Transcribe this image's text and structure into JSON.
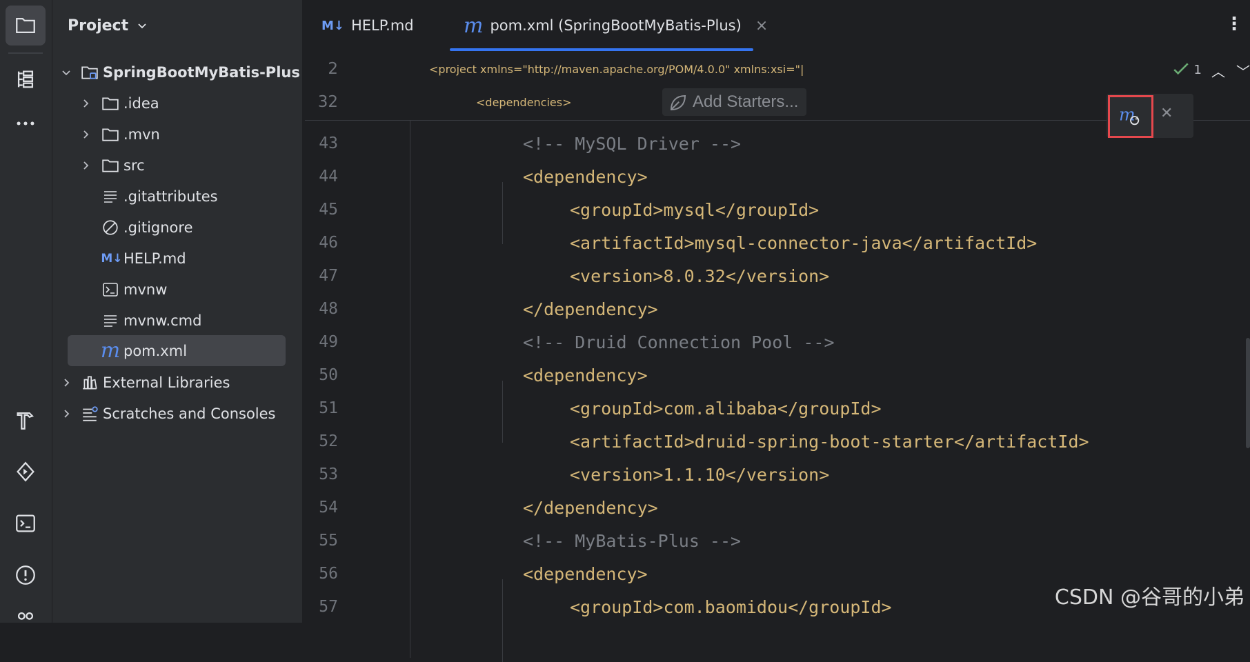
{
  "project_panel": {
    "title": "Project",
    "tree": [
      {
        "label": "SpringBootMyBatis-Plus",
        "icon": "module-folder-icon",
        "expanded": true,
        "bold": true
      },
      {
        "label": ".idea",
        "icon": "folder-icon"
      },
      {
        "label": ".mvn",
        "icon": "folder-icon"
      },
      {
        "label": "src",
        "icon": "folder-icon"
      },
      {
        "label": ".gitattributes",
        "icon": "text-file-icon"
      },
      {
        "label": ".gitignore",
        "icon": "ignore-file-icon"
      },
      {
        "label": "HELP.md",
        "icon": "markdown-icon"
      },
      {
        "label": "mvnw",
        "icon": "shell-script-icon"
      },
      {
        "label": "mvnw.cmd",
        "icon": "text-file-icon"
      },
      {
        "label": "pom.xml",
        "icon": "maven-icon",
        "selected": true
      },
      {
        "label": "External Libraries",
        "icon": "library-icon"
      },
      {
        "label": "Scratches and Consoles",
        "icon": "scratches-icon"
      }
    ]
  },
  "tabs": [
    {
      "label": "HELP.md",
      "icon_text": "M↓"
    },
    {
      "label": "pom.xml (SpringBootMyBatis-Plus)",
      "icon_text": "m",
      "active": true,
      "close": "×"
    }
  ],
  "editor": {
    "add_starters": "Add Starters...",
    "inspection_count": "1",
    "sticky_lines": [
      {
        "num": "2",
        "text": "<project xmlns=\"http://maven.apache.org/POM/4.0.0\" xmlns:xsi=\"|"
      },
      {
        "num": "32",
        "text": "<dependencies>"
      }
    ],
    "lines": [
      {
        "num": "43",
        "text": "<!-- MySQL Driver -->"
      },
      {
        "num": "44",
        "text": "<dependency>"
      },
      {
        "num": "45",
        "text": "<groupId>mysql</groupId>"
      },
      {
        "num": "46",
        "text": "<artifactId>mysql-connector-java</artifactId>"
      },
      {
        "num": "47",
        "text": "<version>8.0.32</version>"
      },
      {
        "num": "48",
        "text": "</dependency>"
      },
      {
        "num": "49",
        "text": "<!-- Druid Connection Pool -->"
      },
      {
        "num": "50",
        "text": "<dependency>"
      },
      {
        "num": "51",
        "text": "<groupId>com.alibaba</groupId>"
      },
      {
        "num": "52",
        "text": "<artifactId>druid-spring-boot-starter</artifactId>"
      },
      {
        "num": "53",
        "text": "<version>1.1.10</version>"
      },
      {
        "num": "54",
        "text": "</dependency>"
      },
      {
        "num": "55",
        "text": "<!-- MyBatis-Plus -->"
      },
      {
        "num": "56",
        "text": "<dependency>"
      },
      {
        "num": "57",
        "text": "<groupId>com.baomidou</groupId>"
      }
    ]
  },
  "watermark": "CSDN @谷哥的小弟",
  "colors": {
    "accent": "#3574f0",
    "highlight_box": "#e5484d",
    "tag": "#d5b778",
    "comment": "#7a7e85",
    "string": "#6aab73"
  }
}
